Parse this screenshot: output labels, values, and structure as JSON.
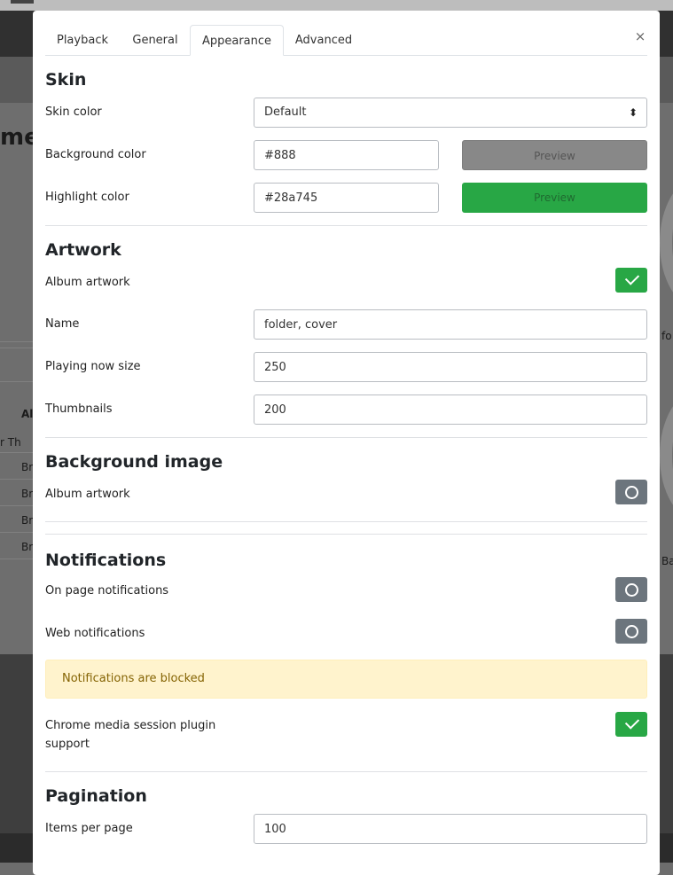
{
  "background": {
    "heading_fragment": "me",
    "side_texts": [
      "Al",
      "r Th",
      "Br",
      "Br",
      "Br",
      "Br"
    ],
    "right_texts": [
      "fo",
      "Ba"
    ]
  },
  "tabs": [
    {
      "label": "Playback"
    },
    {
      "label": "General"
    },
    {
      "label": "Appearance"
    },
    {
      "label": "Advanced"
    }
  ],
  "close_label": "×",
  "skin": {
    "title": "Skin",
    "skin_color_label": "Skin color",
    "skin_color_value": "Default",
    "background_color_label": "Background color",
    "background_color_value": "#888",
    "highlight_color_label": "Highlight color",
    "highlight_color_value": "#28a745",
    "preview_label": "Preview"
  },
  "artwork": {
    "title": "Artwork",
    "album_artwork_label": "Album artwork",
    "album_artwork_enabled": true,
    "name_label": "Name",
    "name_value": "folder, cover",
    "playing_now_size_label": "Playing now size",
    "playing_now_size_value": "250",
    "thumbnails_label": "Thumbnails",
    "thumbnails_value": "200"
  },
  "background_image": {
    "title": "Background image",
    "album_artwork_label": "Album artwork",
    "album_artwork_enabled": false
  },
  "notifications": {
    "title": "Notifications",
    "on_page_label": "On page notifications",
    "on_page_enabled": false,
    "web_label": "Web notifications",
    "web_enabled": false,
    "blocked_message": "Notifications are blocked",
    "chrome_label_line1": "Chrome media session plugin",
    "chrome_label_line2": "support",
    "chrome_enabled": true
  },
  "pagination": {
    "title": "Pagination",
    "items_per_page_label": "Items per page",
    "items_per_page_value": "100"
  },
  "colors": {
    "accent_green": "#28a745",
    "gray_preview": "#888888",
    "toggle_off": "#6c757d",
    "alert_bg": "#fff3cd"
  }
}
